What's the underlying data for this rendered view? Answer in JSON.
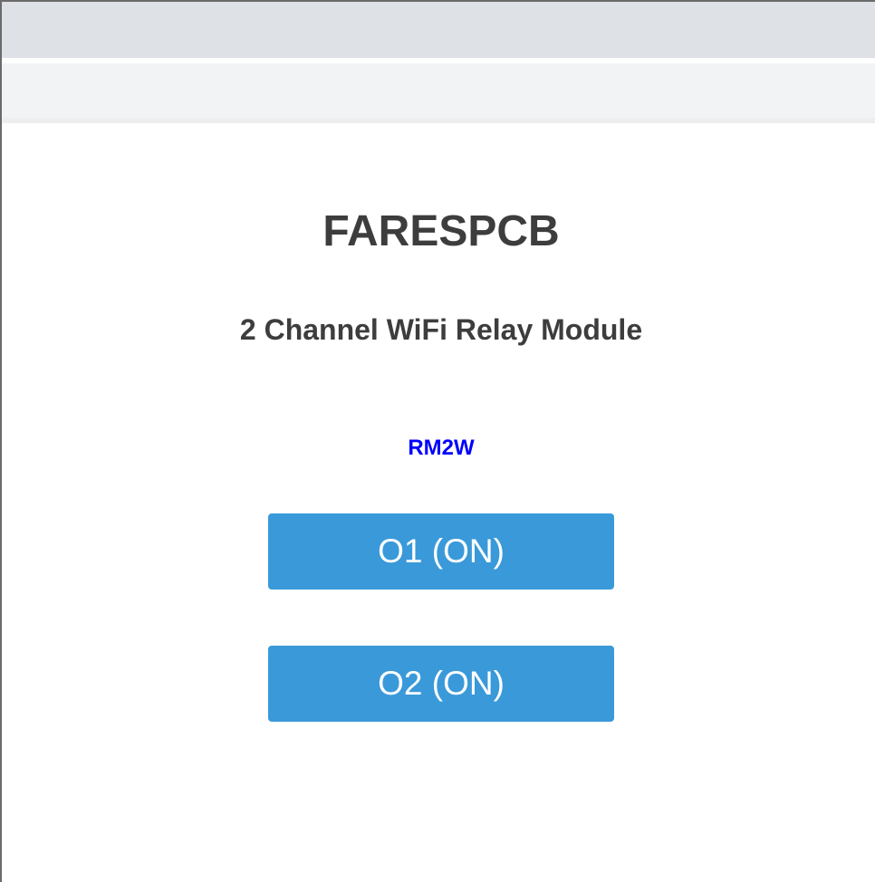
{
  "page": {
    "brand_title": "FARESPCB",
    "subtitle": "2 Channel WiFi Relay Module",
    "model": "RM2W"
  },
  "relays": [
    {
      "label": "O1 (ON)"
    },
    {
      "label": "O2 (ON)"
    }
  ],
  "colors": {
    "button_background": "#3a99d9",
    "button_text": "#ffffff",
    "heading_text": "#3d3d3d",
    "model_text": "#0000ff",
    "tab_strip": "#dee1e6",
    "toolbar": "#f1f3f4"
  }
}
